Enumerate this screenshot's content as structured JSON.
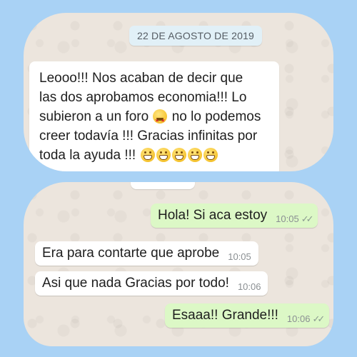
{
  "top_chat": {
    "date": "22 DE AGOSTO DE 2019",
    "message": {
      "line1": "Leooo!!! Nos acaban de decir que",
      "line2": "las dos aprobamos economia!!! Lo",
      "line3_before": "subieron a un foro",
      "line3_after": " no lo podemos",
      "line4": "creer todavía !!! Gracias infinitas  por",
      "line5": "toda la ayuda !!! ",
      "emoji_inline": "star-struck-icon",
      "emoji_trailing": [
        "grimacing-icon",
        "grimacing-icon",
        "grinning-icon",
        "grinning-icon",
        "grinning-icon"
      ]
    }
  },
  "bottom_chat": {
    "messages": [
      {
        "direction": "out",
        "text": "Hola! Si aca estoy",
        "time": "10:05",
        "ticks": "✓✓"
      },
      {
        "direction": "in",
        "text": "Era para contarte que aprobe",
        "time": "10:05"
      },
      {
        "direction": "in",
        "text": "Asi que nada Gracias por todo!",
        "time": "10:06"
      },
      {
        "direction": "out",
        "text": "Esaaa!! Grande!!!",
        "time": "10:06",
        "ticks": "✓✓"
      }
    ]
  },
  "colors": {
    "background": "#a9d2f5",
    "chat_wallpaper": "#ece5dd",
    "outgoing_bubble": "#dcf8c6",
    "incoming_bubble": "#ffffff",
    "date_chip": "#e1f0f7"
  }
}
